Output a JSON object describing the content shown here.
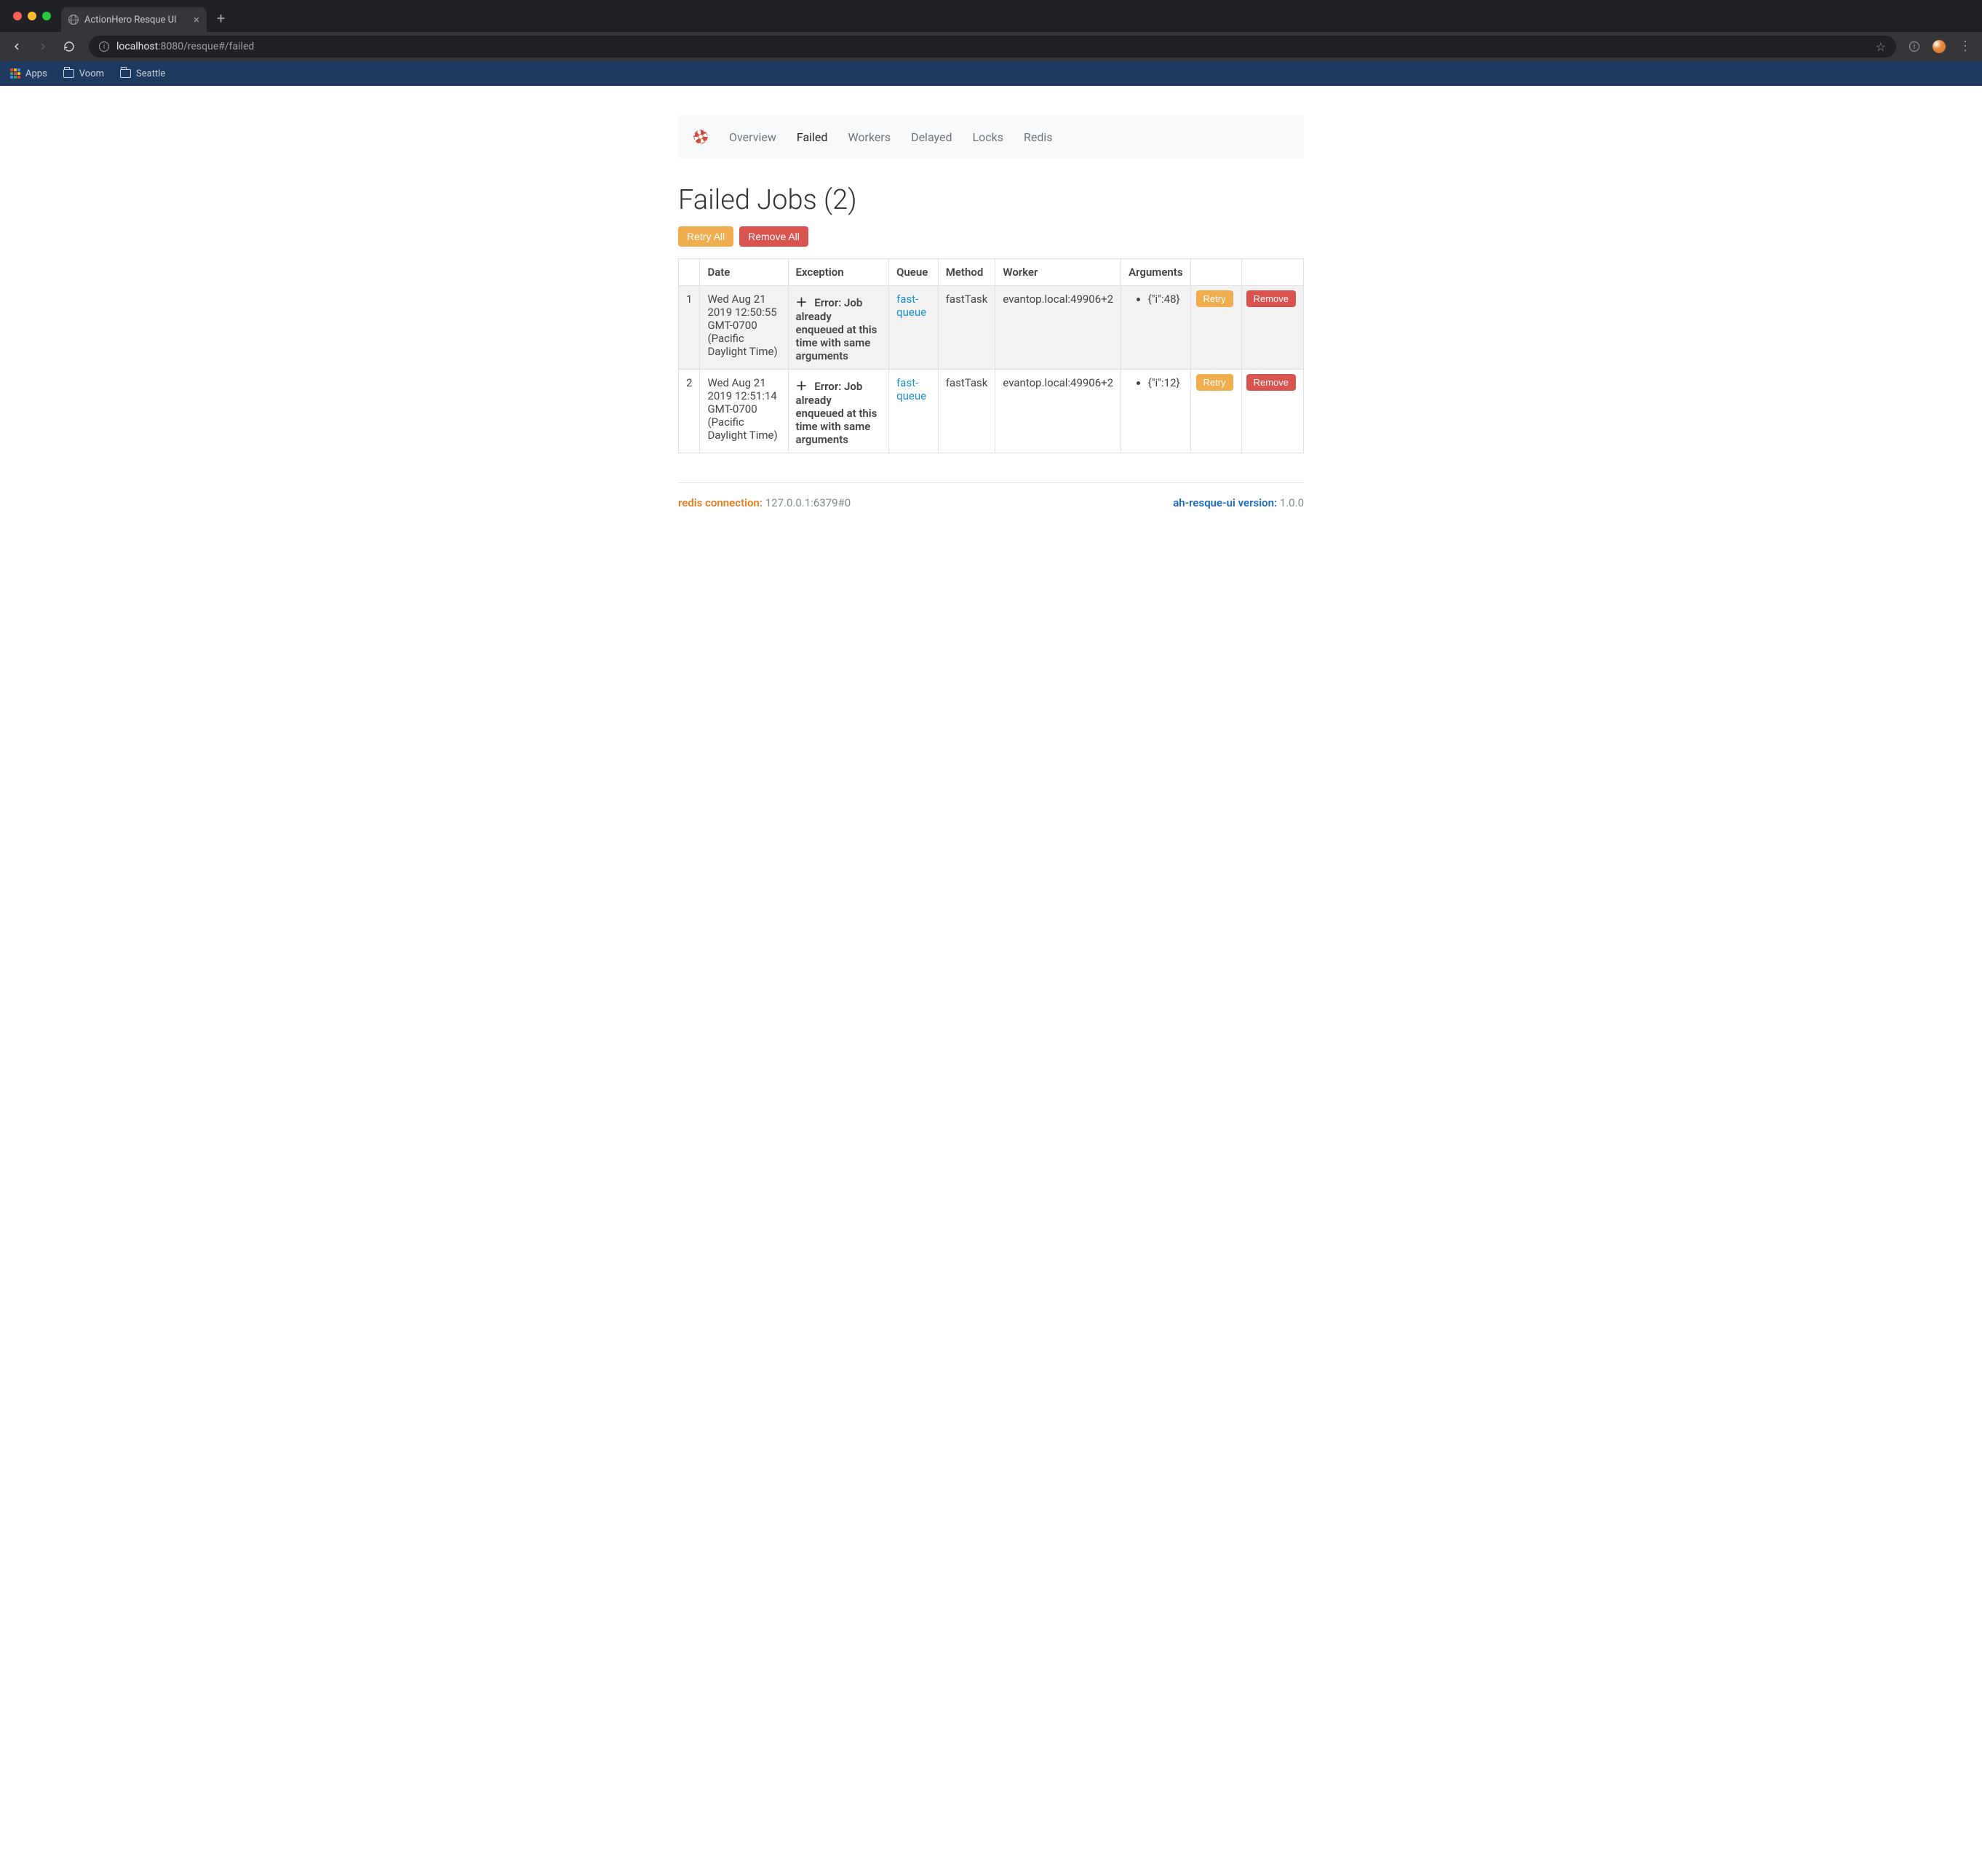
{
  "browser": {
    "tab_title": "ActionHero Resque UI",
    "url_prefix": "ⓘ",
    "url_host": "localhost",
    "url_port_path": ":8080/resque#/failed",
    "bookmarks": {
      "apps": "Apps",
      "voom": "Voom",
      "seattle": "Seattle"
    }
  },
  "nav": {
    "items": [
      "Overview",
      "Failed",
      "Workers",
      "Delayed",
      "Locks",
      "Redis"
    ],
    "active_index": 1
  },
  "page_title": "Failed Jobs (2)",
  "buttons": {
    "retry_all": "Retry All",
    "remove_all": "Remove All",
    "retry": "Retry",
    "remove": "Remove"
  },
  "table": {
    "headers": [
      "",
      "Date",
      "Exception",
      "Queue",
      "Method",
      "Worker",
      "Arguments",
      "",
      ""
    ],
    "rows": [
      {
        "idx": "1",
        "date": "Wed Aug 21 2019 12:50:55 GMT-0700 (Pacific Daylight Time)",
        "exception": "Error: Job already enqueued at this time with same arguments",
        "queue": "fast-queue",
        "method": "fastTask",
        "worker": "evantop.local:49906+2",
        "arguments": "{\"i\":48}"
      },
      {
        "idx": "2",
        "date": "Wed Aug 21 2019 12:51:14 GMT-0700 (Pacific Daylight Time)",
        "exception": "Error: Job already enqueued at this time with same arguments",
        "queue": "fast-queue",
        "method": "fastTask",
        "worker": "evantop.local:49906+2",
        "arguments": "{\"i\":12}"
      }
    ]
  },
  "footer": {
    "redis_label": "redis connection:",
    "redis_value": "127.0.0.1:6379#0",
    "version_label": "ah-resque-ui version:",
    "version_value": "1.0.0"
  }
}
